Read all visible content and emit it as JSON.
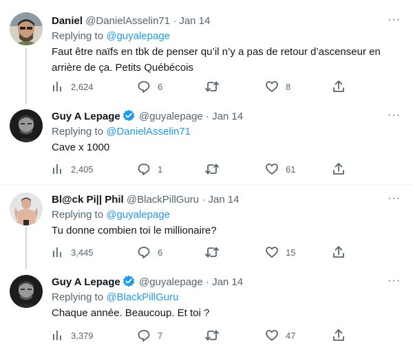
{
  "tweets": [
    {
      "name": "Daniel",
      "handle": "@DanielAsselin71",
      "date": "· Jan 14",
      "verified": false,
      "replying_prefix": "Replying to",
      "replying_to": "@guyalepage",
      "text": "Faut être naïfs en tbk de penser qu’il n’y a pas de retour d’ascenseur en arrière de ça. Petits Québécois",
      "views": "2,624",
      "replies": "6",
      "retweets": "",
      "likes": "8"
    },
    {
      "name": "Guy A Lepage",
      "handle": "@guyalepage",
      "date": "· Jan 14",
      "verified": true,
      "replying_prefix": "Replying to",
      "replying_to": "@DanielAsselin71",
      "text": "Cave x 1000",
      "views": "2,405",
      "replies": "1",
      "retweets": "",
      "likes": "61"
    },
    {
      "name": "Bl@ck Pi|| Phil",
      "handle": "@BlackPillGuru",
      "date": "· Jan 14",
      "verified": false,
      "replying_prefix": "Replying to",
      "replying_to": "@guyalepage",
      "text": "Tu donne combien toi le millionaire?",
      "views": "3,445",
      "replies": "6",
      "retweets": "",
      "likes": "15"
    },
    {
      "name": "Guy A Lepage",
      "handle": "@guyalepage",
      "date": "· Jan 14",
      "verified": true,
      "replying_prefix": "Replying to",
      "replying_to": "@BlackPillGuru",
      "text": "Chaque année. Beaucoup. Et toi ?",
      "views": "3,379",
      "replies": "7",
      "retweets": "",
      "likes": "47"
    }
  ],
  "more_label": "···",
  "colors": {
    "link": "#1d9bf0",
    "muted": "#536471",
    "verified": "#1d9bf0"
  }
}
